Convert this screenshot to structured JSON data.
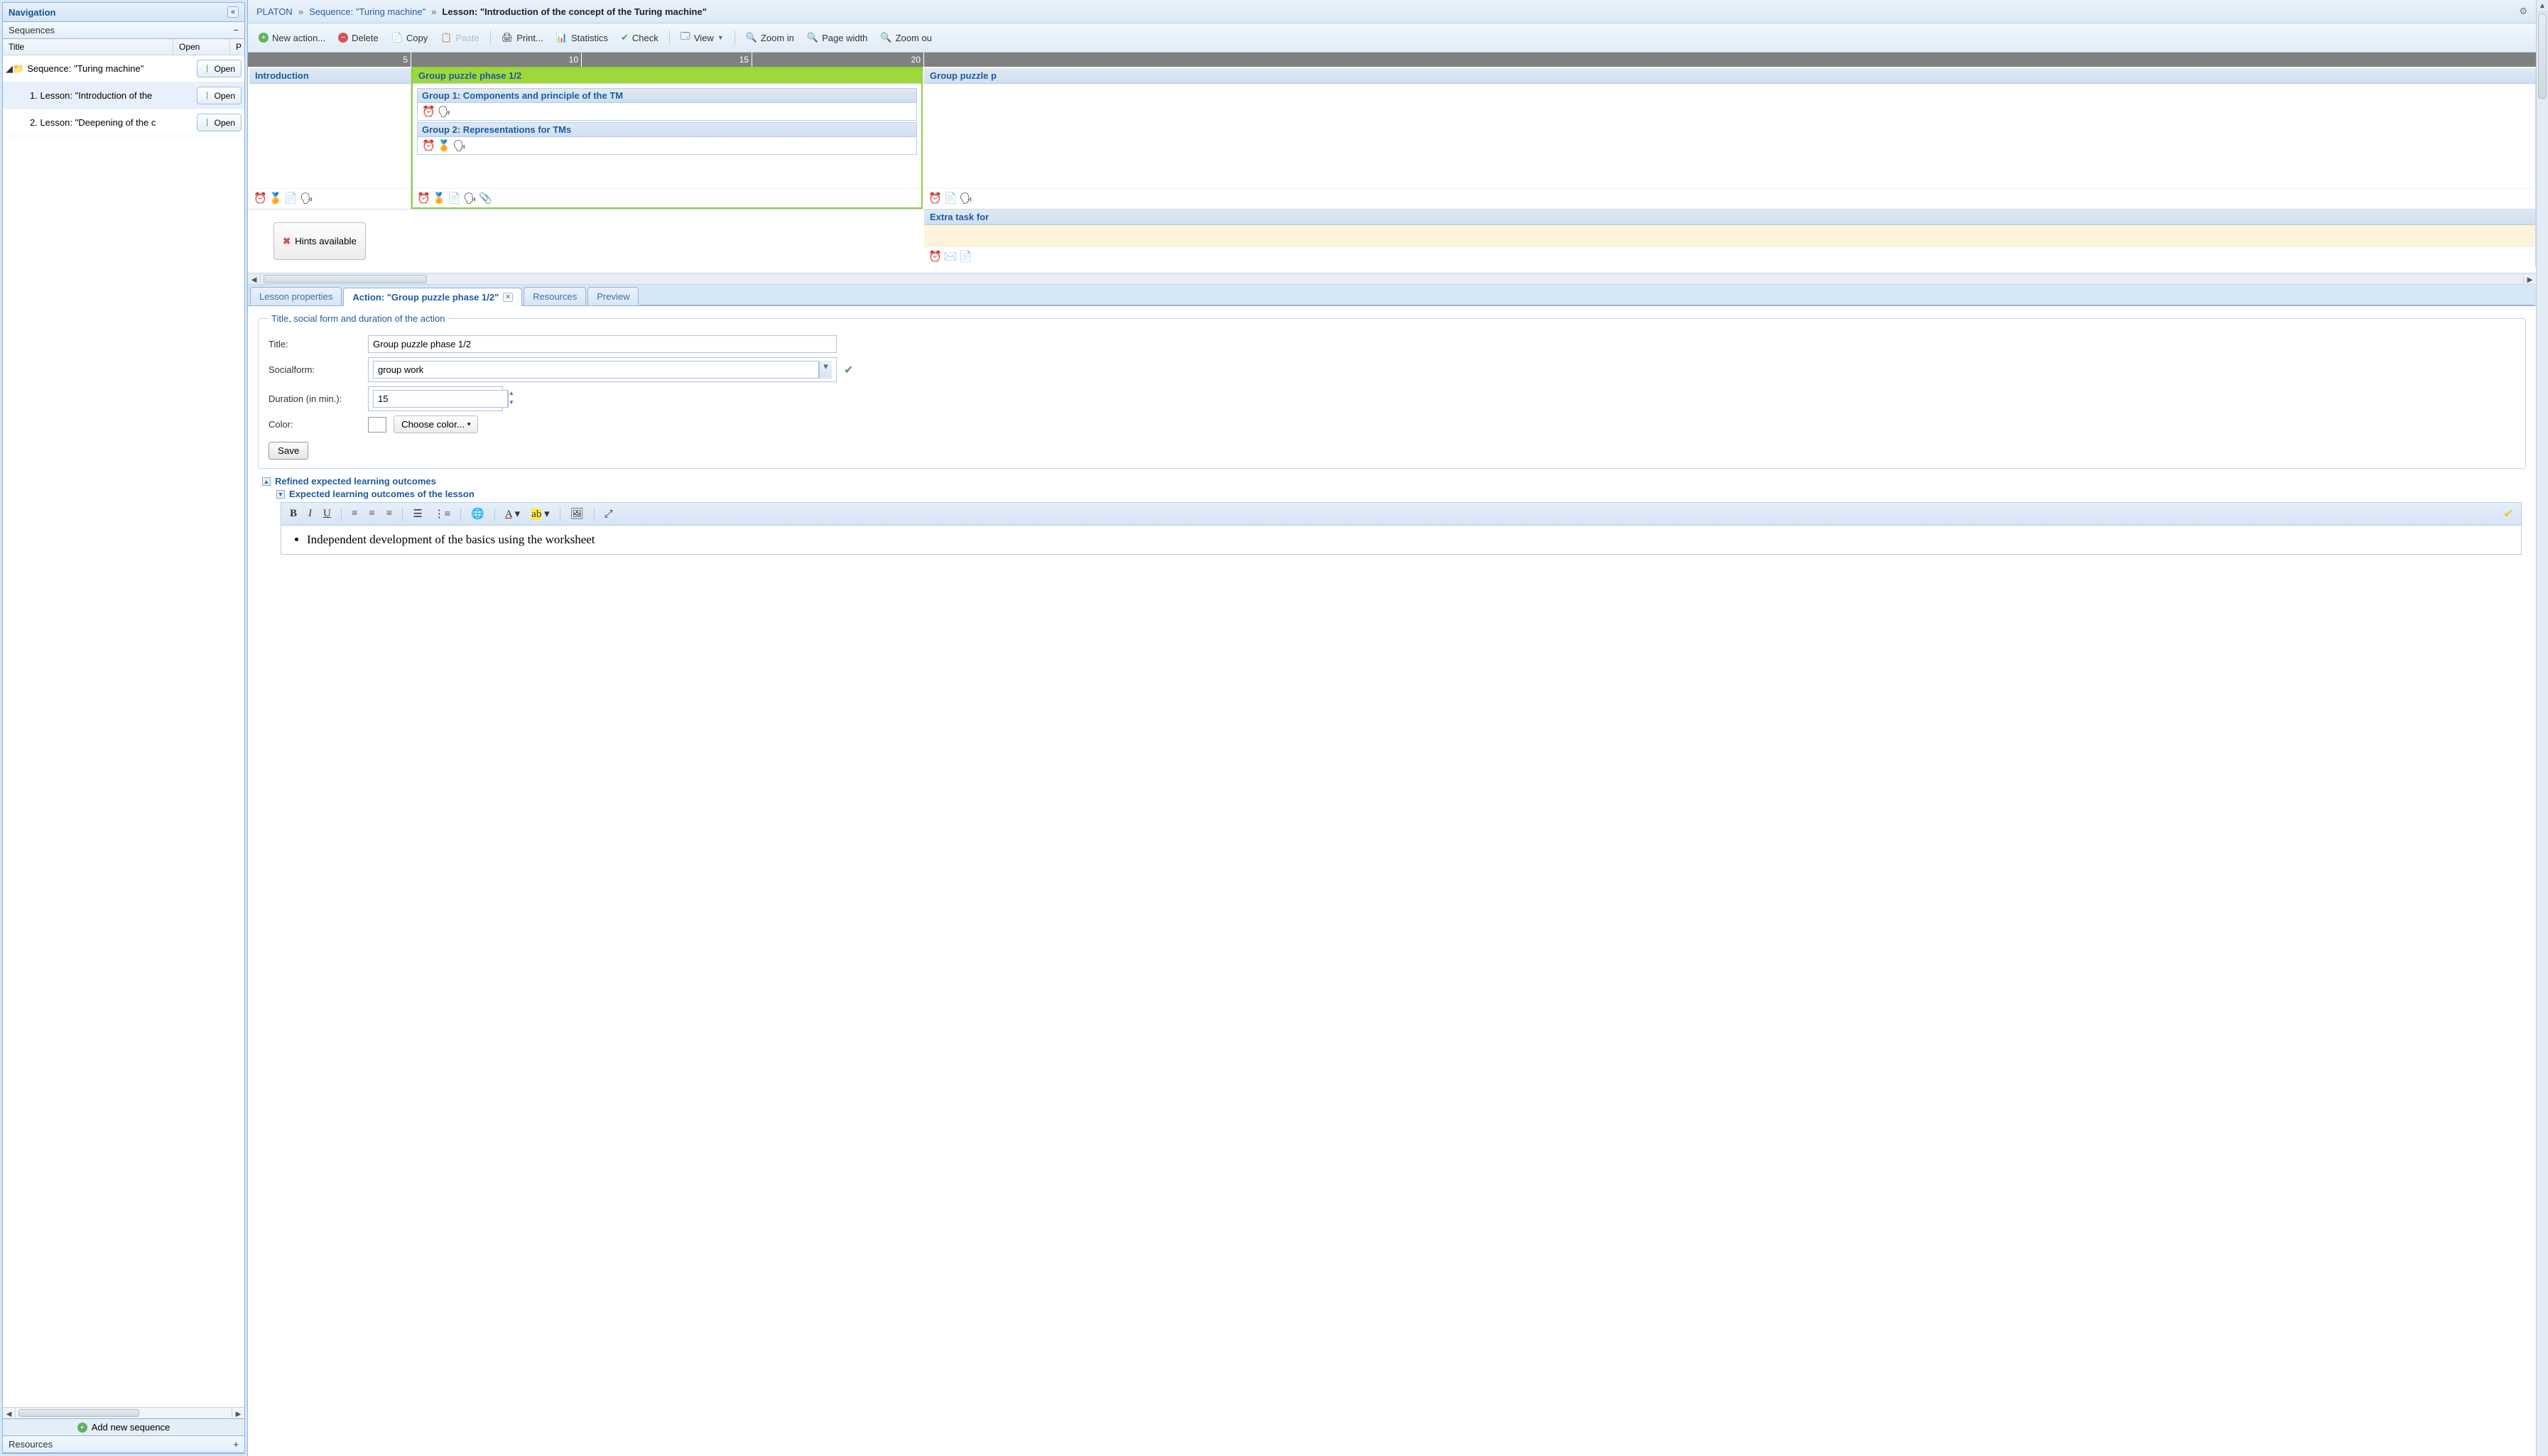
{
  "nav": {
    "title": "Navigation",
    "sequences_title": "Sequences",
    "columns": {
      "title": "Title",
      "open": "Open",
      "p": "P"
    },
    "tree": [
      {
        "label": "Sequence: \"Turing machine\"",
        "open": "Open",
        "indent": 0,
        "expandable": true,
        "folder": true
      },
      {
        "label": "1. Lesson: \"Introduction of the",
        "open": "Open",
        "indent": 1,
        "selected": true
      },
      {
        "label": "2. Lesson: \"Deepening of the c",
        "open": "Open",
        "indent": 1
      }
    ],
    "add_sequence": "Add new sequence",
    "resources_title": "Resources"
  },
  "breadcrumb": {
    "root": "PLATON",
    "seq": "Sequence: \"Turing machine\"",
    "lesson": "Lesson: \"Introduction of the concept of the Turing machine\""
  },
  "toolbar": {
    "new_action": "New action...",
    "delete": "Delete",
    "copy": "Copy",
    "paste": "Paste",
    "print": "Print...",
    "statistics": "Statistics",
    "check": "Check",
    "view": "View",
    "zoom_in": "Zoom in",
    "page_width": "Page width",
    "zoom_out": "Zoom ou"
  },
  "ruler": {
    "t5": "5",
    "t10": "10",
    "t15": "15",
    "t20": "20"
  },
  "blocks": {
    "intro": "Introduction",
    "gp1": "Group puzzle phase 1/2",
    "gp1_g1": "Group 1: Components and principle of the TM",
    "gp1_g2": "Group 2: Representations for TMs",
    "gp2": "Group puzzle p",
    "extra": "Extra task for"
  },
  "hints": "Hints available",
  "tabs": {
    "lesson_props": "Lesson properties",
    "action": "Action: \"Group puzzle phase 1/2\"",
    "resources": "Resources",
    "preview": "Preview"
  },
  "form": {
    "fieldset_title": "Title, social form and duration of the action",
    "title_label": "Title:",
    "title_value": "Group puzzle phase 1/2",
    "socialform_label": "Socialform:",
    "socialform_value": "group work",
    "duration_label": "Duration (in min.):",
    "duration_value": "15",
    "color_label": "Color:",
    "choose_color": "Choose color...",
    "save": "Save",
    "legend_refined": "Refined expected learning outcomes",
    "legend_expected": "Expected learning outcomes of the lesson",
    "rte_bullet": "Independent development of the basics using the worksheet"
  }
}
